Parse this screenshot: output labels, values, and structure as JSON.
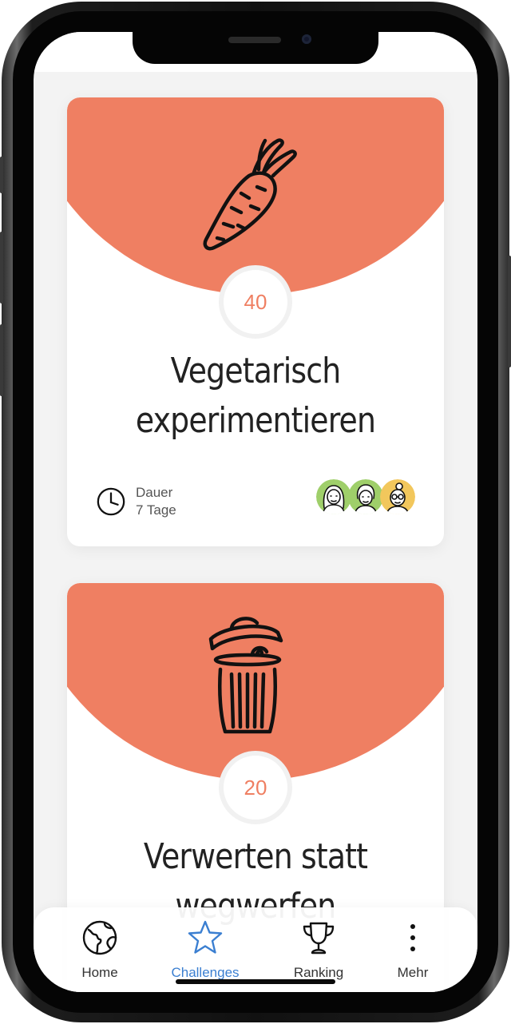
{
  "challenges": [
    {
      "points": "40",
      "title_line1": "Vegetarisch",
      "title_line2": "experimentieren",
      "duration_label": "Dauer",
      "duration_value": "7 Tage",
      "icon": "carrot-icon"
    },
    {
      "points": "20",
      "title_line1": "Verwerten statt",
      "title_line2": "wegwerfen",
      "icon": "trash-can-icon"
    }
  ],
  "tabbar": {
    "items": [
      {
        "label": "Home",
        "icon": "globe-icon"
      },
      {
        "label": "Challenges",
        "icon": "star-icon",
        "active": true
      },
      {
        "label": "Ranking",
        "icon": "trophy-icon"
      },
      {
        "label": "Mehr",
        "icon": "more-vertical-icon"
      }
    ]
  },
  "colors": {
    "accent": "#ef7f62",
    "active_tab": "#3b7fd1",
    "background": "#f3f3f3"
  }
}
